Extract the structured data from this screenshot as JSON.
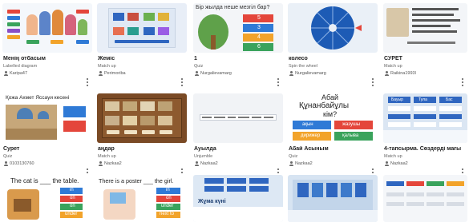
{
  "cards": [
    {
      "title": "Менің отбасым",
      "type": "Labelled diagram",
      "author": "Karipa47"
    },
    {
      "title": "Жеміс",
      "type": "Match up",
      "author": "Perimoriba"
    },
    {
      "title": "1",
      "type": "Quiz",
      "author": "Nurgalievamarg"
    },
    {
      "title": "колесо",
      "type": "Spin the wheel",
      "author": "Nurgalievamarg"
    },
    {
      "title": "СУРЕТ",
      "type": "Match up",
      "author": "Raikina1993l"
    },
    {
      "title": "Қожа Ахмет Яссауи кесені",
      "type": "",
      "author": ""
    },
    {
      "title": "Сурет",
      "type": "Quiz",
      "author": "0103130760"
    },
    {
      "title": "аңдар",
      "type": "Match up",
      "author": "Nazkaa2"
    },
    {
      "title": "Ауылда",
      "type": "Unjumble",
      "author": "Nazkaa2"
    },
    {
      "title": "Абай Асыным",
      "type": "Quiz",
      "author": "Nazkaa2"
    },
    {
      "title": "4-тапсырма. Сөздерді мағына",
      "type": "Match up",
      "author": "Nazkaa2"
    }
  ],
  "thumb_text": {
    "quiz_question": "Бір жылда неше мезгіл бар?",
    "quiz_answers": [
      "5",
      "3",
      "4",
      "6"
    ],
    "wheel_colors_note": "",
    "abai_question_1": "Абай",
    "abai_question_2": "Құнанбайұлы",
    "abai_question_3": "кім?",
    "abai_answers": [
      "ақын",
      "жазушы",
      "дирижер",
      "қалыва"
    ],
    "cat_sentence": "The cat is ___ the table.",
    "poster_sentence": "There is a poster ___ the girl.",
    "cat_options": [
      "in",
      "on",
      "on",
      "under"
    ],
    "poster_options": [
      "in",
      "on",
      "under",
      "next to"
    ],
    "wheel_label": "",
    "bottom_mid_label": "Жұма күні",
    "sozder_words": [
      "Бауыр",
      "Тула",
      "Бас"
    ]
  }
}
